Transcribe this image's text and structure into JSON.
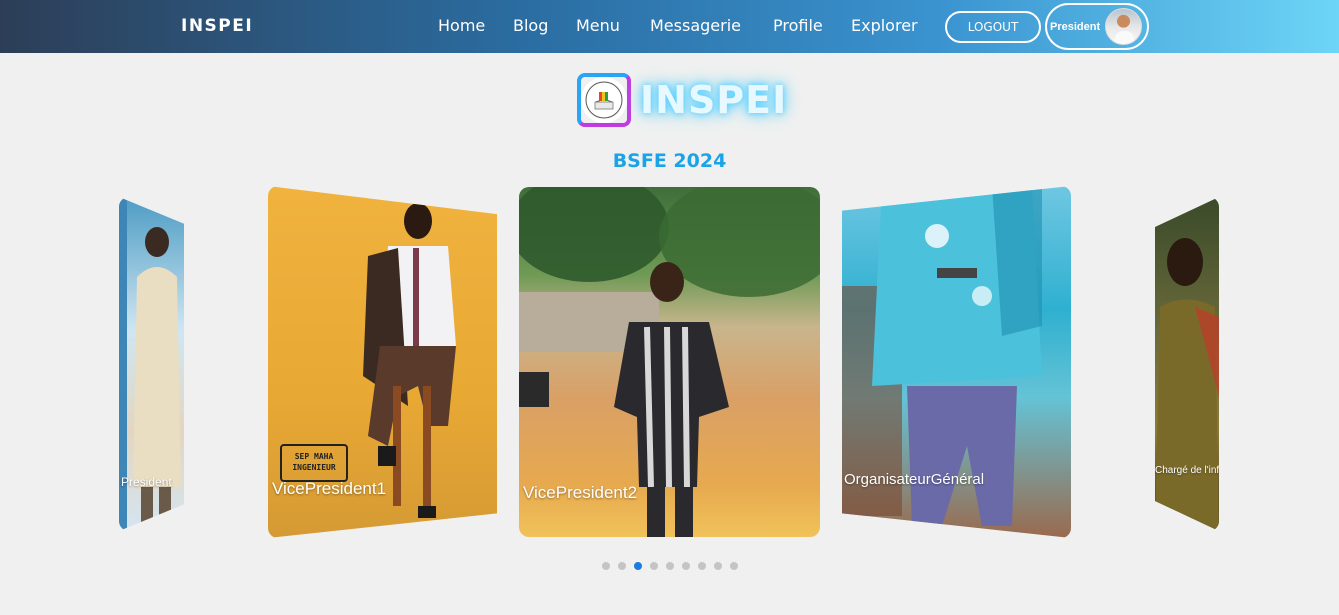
{
  "navbar": {
    "brand": "INSPEI",
    "links": [
      "Home",
      "Blog",
      "Menu",
      "Messagerie",
      "Profile",
      "Explorer"
    ],
    "logout_label": "LOGOUT",
    "user_label": "President"
  },
  "header": {
    "site_title": "INSPEI",
    "logo_icon": "school-emblem-icon"
  },
  "carousel": {
    "title": "BSFE 2024",
    "slides": [
      {
        "caption": "President"
      },
      {
        "caption": "VicePresident1"
      },
      {
        "caption": "VicePresident2"
      },
      {
        "caption": "OrganisateurGénéral"
      },
      {
        "caption": "Chargé de l'information"
      }
    ],
    "badge_text": "SEP MAHA INGENIEUR",
    "dot_count": 9,
    "active_dot_index": 2
  },
  "colors": {
    "accent": "#1aa3e8",
    "active_dot": "#1a7be0",
    "title_glow": "#5dd1ff"
  }
}
